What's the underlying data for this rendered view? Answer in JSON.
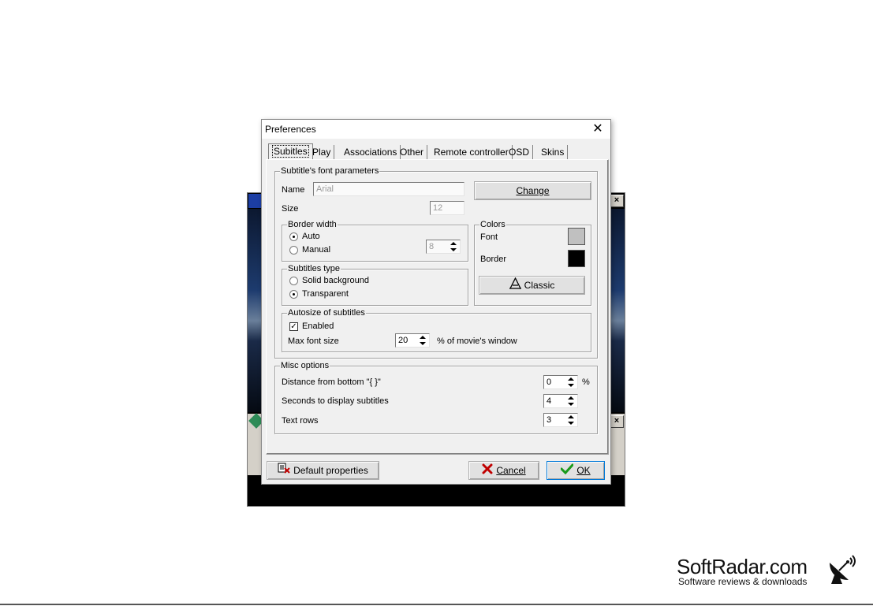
{
  "dialog": {
    "title": "Preferences",
    "close_glyph": "✕"
  },
  "tabs": [
    {
      "label": "Subitles",
      "selected": true
    },
    {
      "label": "Play"
    },
    {
      "label": "Associations"
    },
    {
      "label": "Other"
    },
    {
      "label": "Remote controller"
    },
    {
      "label": "OSD"
    },
    {
      "label": "Skins"
    }
  ],
  "font_params": {
    "legend": "Subtitle's font parameters",
    "name_label": "Name",
    "name_value": "Arial",
    "size_label": "Size",
    "size_value": "12",
    "change_button": "Change"
  },
  "border_width": {
    "legend": "Border width",
    "auto_label": "Auto",
    "manual_label": "Manual",
    "selected": "Auto",
    "manual_value": "8"
  },
  "colors": {
    "legend": "Colors",
    "font_label": "Font",
    "font_color": "#c0c0c0",
    "border_label": "Border",
    "border_color": "#000000",
    "classic_button": "Classic"
  },
  "subtitles_type": {
    "legend": "Subtitles type",
    "solid_label": "Solid background",
    "transparent_label": "Transparent",
    "selected": "Transparent"
  },
  "autosize": {
    "legend": "Autosize of subtitles",
    "enabled_label": "Enabled",
    "enabled": true,
    "max_font_label": "Max font size",
    "max_font_value": "20",
    "max_font_suffix": "% of movie's window"
  },
  "misc": {
    "legend": "Misc options",
    "distance_label": "Distance from bottom  \"{ }\"",
    "distance_value": "0",
    "distance_suffix": "%",
    "seconds_label": "Seconds to display subtitles",
    "seconds_value": "4",
    "rows_label": "Text rows",
    "rows_value": "3"
  },
  "footer": {
    "default_button": "Default properties",
    "cancel_button": "Cancel",
    "ok_button": "OK"
  },
  "watermark": {
    "title": "SoftRadar.com",
    "subtitle": "Software reviews & downloads"
  }
}
